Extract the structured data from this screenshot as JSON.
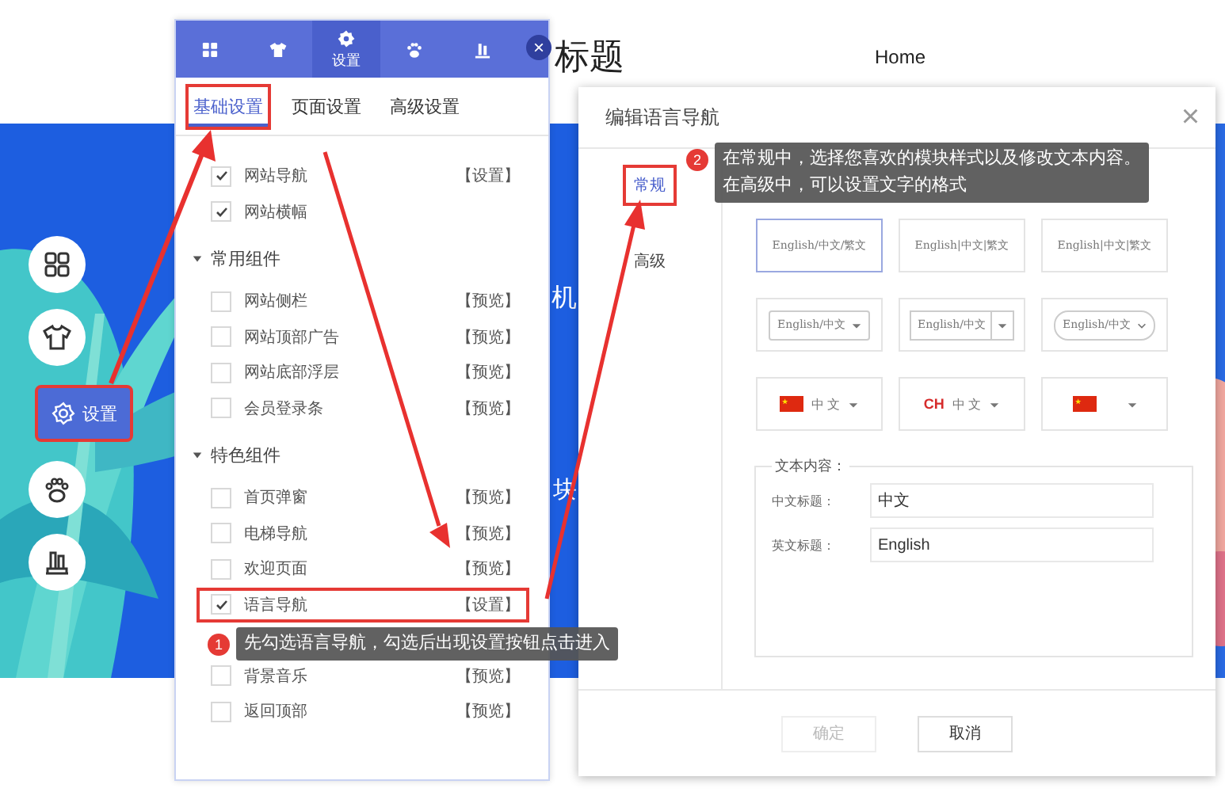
{
  "page": {
    "title": "标题",
    "nav": [
      "Home"
    ],
    "hero_texts": [
      "机",
      "块"
    ]
  },
  "side_menu": [
    {
      "kind": "grid",
      "selected": false
    },
    {
      "kind": "shirt",
      "selected": false
    },
    {
      "kind": "settings",
      "label": "设置",
      "selected": true,
      "highlighted": true
    },
    {
      "kind": "paw",
      "selected": false
    },
    {
      "kind": "building",
      "selected": false
    }
  ],
  "panel": {
    "tabs": [
      {
        "kind": "grid",
        "selected": false
      },
      {
        "kind": "shirt",
        "selected": false
      },
      {
        "kind": "settings",
        "label": "设置",
        "selected": true
      },
      {
        "kind": "paw",
        "selected": false
      },
      {
        "kind": "building",
        "selected": false
      }
    ],
    "close": "×",
    "subtabs": [
      {
        "label": "基础设置",
        "selected": true,
        "highlighted": true
      },
      {
        "label": "页面设置",
        "selected": false,
        "highlighted": false
      },
      {
        "label": "高级设置",
        "selected": false,
        "highlighted": false
      }
    ],
    "sections": [
      {
        "items": [
          {
            "label": "网站导航",
            "checked": true,
            "action": "【设置】"
          },
          {
            "label": "网站横幅",
            "checked": true
          }
        ]
      },
      {
        "title": "常用组件",
        "expanded": true,
        "items": [
          {
            "label": "网站侧栏",
            "checked": false,
            "action": "【预览】"
          },
          {
            "label": "网站顶部广告",
            "checked": false,
            "action": "【预览】"
          },
          {
            "label": "网站底部浮层",
            "checked": false,
            "action": "【预览】"
          },
          {
            "label": "会员登录条",
            "checked": false,
            "action": "【预览】"
          }
        ]
      },
      {
        "title": "特色组件",
        "expanded": true,
        "items": [
          {
            "label": "首页弹窗",
            "checked": false,
            "action": "【预览】"
          },
          {
            "label": "电梯导航",
            "checked": false,
            "action": "【预览】"
          },
          {
            "label": "欢迎页面",
            "checked": false,
            "action": "【预览】"
          },
          {
            "label": "语言导航",
            "checked": true,
            "action": "【设置】",
            "highlighted": true
          },
          {
            "kind": "hidden"
          },
          {
            "label": "背景音乐",
            "checked": false,
            "action": "【预览】"
          },
          {
            "label": "返回顶部",
            "checked": false,
            "action": "【预览】"
          }
        ]
      }
    ]
  },
  "dialog": {
    "title": "编辑语言导航",
    "close": "×",
    "tabs": [
      {
        "label": "常规",
        "selected": true,
        "highlighted": true
      },
      {
        "label": "高级",
        "selected": false,
        "highlighted": false
      }
    ],
    "styles": [
      {
        "kind": "text",
        "label": "English/中文/繁文",
        "selected": true
      },
      {
        "kind": "text",
        "label": "English|中文|繁文",
        "selected": false
      },
      {
        "kind": "text",
        "label": "English|中文|繁文",
        "selected": false
      },
      {
        "kind": "dropdown",
        "label": "English/中文",
        "selected": false
      },
      {
        "kind": "split-dropdown",
        "label": "English/中文",
        "selected": false
      },
      {
        "kind": "rounded-dropdown",
        "label": "English/中文",
        "selected": false
      },
      {
        "kind": "flag-dropdown",
        "label": "中 文",
        "selected": false
      },
      {
        "kind": "code-dropdown",
        "code": "CH",
        "label": "中 文",
        "selected": false
      },
      {
        "kind": "flag-only",
        "selected": false
      }
    ],
    "fieldset": {
      "legend": "文本内容：",
      "fields": [
        {
          "label": "中文标题：",
          "value": "中文"
        },
        {
          "label": "英文标题：",
          "value": "English"
        }
      ]
    },
    "buttons": [
      {
        "label": "确定",
        "disabled": true
      },
      {
        "label": "取消",
        "disabled": false
      }
    ]
  },
  "callouts": [
    {
      "number": "1",
      "lines": [
        "先勾选语言导航，勾选后出现设置按钮点击进入"
      ]
    },
    {
      "number": "2",
      "lines": [
        "在常规中，选择您喜欢的模块样式以及修改文本内容。",
        "在高级中，可以设置文字的格式"
      ]
    }
  ]
}
